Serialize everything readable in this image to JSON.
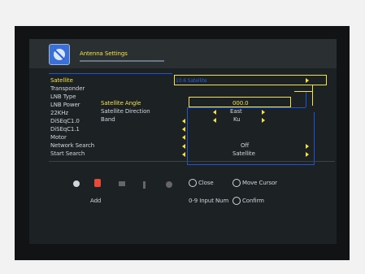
{
  "header": {
    "title": "Antenna Settings",
    "icon": "satellite-dish-icon"
  },
  "menu": {
    "items": [
      "Satellite",
      "Transponder",
      "LNB Type",
      "LNB Power",
      "22KHz",
      "DiSEqC1.0",
      "DiSEqC1.1",
      "Motor",
      "Network Search",
      "Start Search"
    ],
    "selected": "Satellite"
  },
  "satellite_value": "10.6 Satellite",
  "sub_labels": [
    "Satellite Angle",
    "Satellite Direction",
    "Band"
  ],
  "sub_values": {
    "angle": "000.0",
    "direction": "East",
    "band": "Ku"
  },
  "network_search_value": "Off",
  "start_search_value": "Satellite",
  "footer": {
    "add_label": "Add",
    "close_label": "Close",
    "move_cursor_label": "Move Cursor",
    "input_num_label": "0-9  Input Num",
    "confirm_label": "Confirm"
  },
  "colors": {
    "accent": "#f3e24a",
    "label": "#cfd6dc",
    "link_line": "#1f54d6",
    "panel": "#1c2224"
  }
}
